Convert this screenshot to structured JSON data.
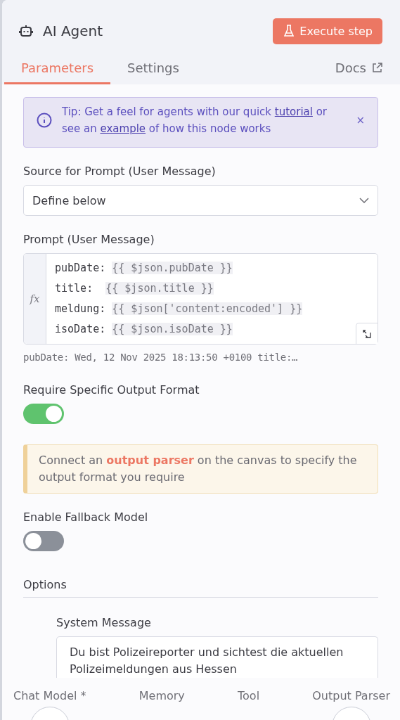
{
  "header": {
    "title": "AI Agent",
    "execute_button": "Execute step"
  },
  "tabs": [
    {
      "label": "Parameters",
      "selected": true
    },
    {
      "label": "Settings",
      "selected": false
    }
  ],
  "docs_link": "Docs",
  "tip": {
    "parts": [
      {
        "kind": "text",
        "text": "Tip: Get a feel for agents with our quick "
      },
      {
        "kind": "link",
        "text": "tutorial"
      },
      {
        "kind": "text",
        "text": " or see an "
      },
      {
        "kind": "link",
        "text": "example"
      },
      {
        "kind": "text",
        "text": " of how this node works"
      }
    ],
    "close": "×"
  },
  "source_select": {
    "label": "Source for Prompt (User Message)",
    "value": "Define below"
  },
  "prompt": {
    "label": "Prompt (User Message)",
    "fx": "fx",
    "lines": [
      {
        "key": "pubDate: ",
        "expr": "{{ $json.pubDate }}"
      },
      {
        "key": "title:  ",
        "expr": "{{ $json.title }}"
      },
      {
        "key": "meldung: ",
        "expr": "{{ $json['content:encoded'] }}"
      },
      {
        "key": "isoDate: ",
        "expr": "{{ $json.isoDate }}"
      }
    ],
    "preview": "pubDate: Wed, 12 Nov 2025 18:13:50 +0100 title:…"
  },
  "require_output_format": {
    "label": "Require Specific Output Format",
    "on": true
  },
  "notice": {
    "parts": [
      {
        "kind": "text",
        "text": "Connect an "
      },
      {
        "kind": "strong",
        "text": "output parser"
      },
      {
        "kind": "text",
        "text": " on the canvas to specify the output format you require"
      }
    ]
  },
  "fallback_model": {
    "label": "Enable Fallback Model",
    "on": false
  },
  "options": {
    "label": "Options",
    "system_message": {
      "label": "System Message",
      "value": "Du bist Polizeireporter und sichtest die aktuellen Polizeimeldungen aus Hessen"
    }
  },
  "connectors": [
    {
      "label": "Chat Model *",
      "circle": true
    },
    {
      "label": "Memory",
      "circle": false
    },
    {
      "label": "Tool",
      "circle": false
    },
    {
      "label": "Output Parser",
      "circle": true
    }
  ]
}
